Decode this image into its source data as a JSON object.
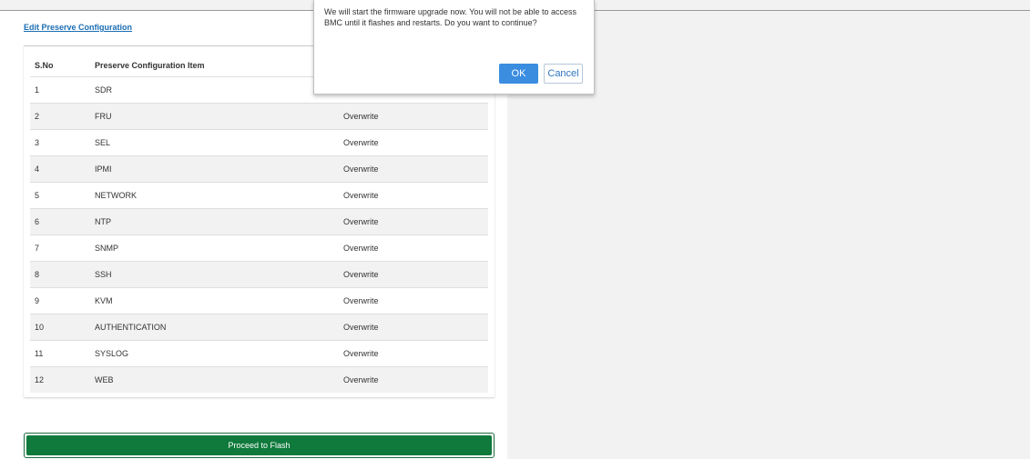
{
  "page": {
    "edit_link": "Edit Preserve Configuration",
    "table": {
      "headers": {
        "sno": "S.No",
        "item": "Preserve Configuration Item"
      },
      "rows": [
        {
          "sno": "1",
          "item": "SDR",
          "mode": ""
        },
        {
          "sno": "2",
          "item": "FRU",
          "mode": "Overwrite"
        },
        {
          "sno": "3",
          "item": "SEL",
          "mode": "Overwrite"
        },
        {
          "sno": "4",
          "item": "IPMI",
          "mode": "Overwrite"
        },
        {
          "sno": "5",
          "item": "NETWORK",
          "mode": "Overwrite"
        },
        {
          "sno": "6",
          "item": "NTP",
          "mode": "Overwrite"
        },
        {
          "sno": "7",
          "item": "SNMP",
          "mode": "Overwrite"
        },
        {
          "sno": "8",
          "item": "SSH",
          "mode": "Overwrite"
        },
        {
          "sno": "9",
          "item": "KVM",
          "mode": "Overwrite"
        },
        {
          "sno": "10",
          "item": "AUTHENTICATION",
          "mode": "Overwrite"
        },
        {
          "sno": "11",
          "item": "SYSLOG",
          "mode": "Overwrite"
        },
        {
          "sno": "12",
          "item": "WEB",
          "mode": "Overwrite"
        }
      ]
    },
    "proceed_button": "Proceed to Flash"
  },
  "dialog": {
    "message": "We will start the firmware upgrade now. You will not be able to access BMC until it flashes and restarts. Do you want to continue?",
    "ok_label": "OK",
    "cancel_label": "Cancel"
  },
  "colors": {
    "proceed_bg": "#0f7a3c",
    "ok_bg": "#3b8de0",
    "link": "#1a6db3"
  }
}
